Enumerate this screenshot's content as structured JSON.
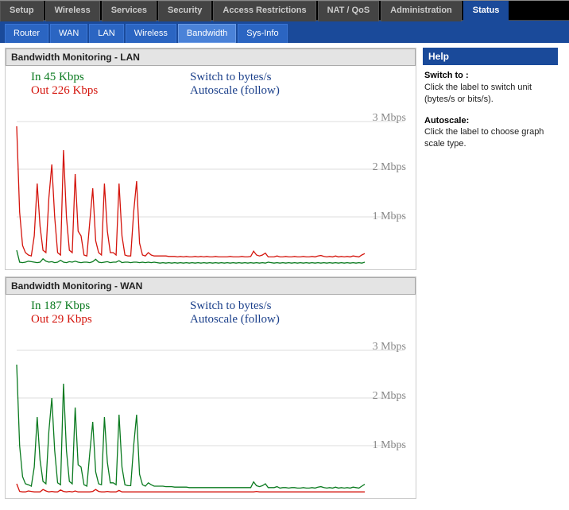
{
  "topnav": [
    {
      "label": "Setup",
      "active": false
    },
    {
      "label": "Wireless",
      "active": false
    },
    {
      "label": "Services",
      "active": false
    },
    {
      "label": "Security",
      "active": false
    },
    {
      "label": "Access Restrictions",
      "active": false
    },
    {
      "label": "NAT / QoS",
      "active": false
    },
    {
      "label": "Administration",
      "active": false
    },
    {
      "label": "Status",
      "active": true
    }
  ],
  "subnav": [
    {
      "label": "Router",
      "active": false
    },
    {
      "label": "WAN",
      "active": false
    },
    {
      "label": "LAN",
      "active": false
    },
    {
      "label": "Wireless",
      "active": false
    },
    {
      "label": "Bandwidth",
      "active": true
    },
    {
      "label": "Sys-Info",
      "active": false
    }
  ],
  "panels": {
    "lan": {
      "title": "Bandwidth Monitoring - LAN",
      "in_prefix": "In  ",
      "in_value": "45 Kbps",
      "out_prefix": "Out  ",
      "out_value": "226 Kbps",
      "switch": "Switch to bytes/s",
      "autoscale": "Autoscale (follow)"
    },
    "wan": {
      "title": "Bandwidth Monitoring - WAN",
      "in_prefix": "In  ",
      "in_value": "187 Kbps",
      "out_prefix": "Out  ",
      "out_value": "29 Kbps",
      "switch": "Switch to bytes/s",
      "autoscale": "Autoscale (follow)"
    }
  },
  "yticks": [
    "3 Mbps",
    "2 Mbps",
    "1 Mbps"
  ],
  "help": {
    "title": "Help",
    "switch_h": "Switch to :",
    "switch_t": "Click the label to switch unit (bytes/s or bits/s).",
    "auto_h": "Autoscale:",
    "auto_t": "Click the label to choose graph scale type."
  },
  "chart_data": [
    {
      "name": "LAN",
      "type": "line",
      "title": "Bandwidth Monitoring - LAN",
      "xlabel": "",
      "ylabel": "",
      "ylim": [
        0,
        3.3
      ],
      "y_unit": "Mbps",
      "y_ticks": [
        1,
        2,
        3
      ],
      "n_samples": 120,
      "series": [
        {
          "name": "In",
          "color": "#0a7a1f",
          "current_kbps": 45,
          "values": [
            0.3,
            0.05,
            0.04,
            0.05,
            0.07,
            0.06,
            0.05,
            0.04,
            0.05,
            0.12,
            0.07,
            0.05,
            0.06,
            0.04,
            0.05,
            0.09,
            0.05,
            0.04,
            0.06,
            0.05,
            0.07,
            0.05,
            0.04,
            0.05,
            0.05,
            0.04,
            0.06,
            0.11,
            0.05,
            0.04,
            0.05,
            0.06,
            0.04,
            0.05,
            0.05,
            0.08,
            0.04,
            0.05,
            0.05,
            0.04,
            0.05,
            0.05,
            0.04,
            0.05,
            0.04,
            0.05,
            0.04,
            0.05,
            0.04,
            0.03,
            0.04,
            0.03,
            0.04,
            0.03,
            0.04,
            0.03,
            0.04,
            0.03,
            0.04,
            0.03,
            0.04,
            0.03,
            0.04,
            0.03,
            0.04,
            0.03,
            0.04,
            0.03,
            0.04,
            0.03,
            0.04,
            0.03,
            0.04,
            0.03,
            0.04,
            0.03,
            0.04,
            0.03,
            0.04,
            0.03,
            0.04,
            0.03,
            0.04,
            0.03,
            0.04,
            0.03,
            0.05,
            0.04,
            0.03,
            0.04,
            0.03,
            0.04,
            0.03,
            0.04,
            0.03,
            0.04,
            0.03,
            0.04,
            0.03,
            0.04,
            0.03,
            0.04,
            0.03,
            0.04,
            0.03,
            0.04,
            0.03,
            0.04,
            0.03,
            0.04,
            0.03,
            0.04,
            0.03,
            0.04,
            0.03,
            0.04,
            0.03,
            0.04,
            0.03,
            0.05
          ]
        },
        {
          "name": "Out",
          "color": "#d4140c",
          "current_kbps": 226,
          "values": [
            2.9,
            1.1,
            0.4,
            0.25,
            0.2,
            0.18,
            0.6,
            1.7,
            0.8,
            0.3,
            0.25,
            1.4,
            2.1,
            1.0,
            0.25,
            0.2,
            2.4,
            1.0,
            0.3,
            0.25,
            1.9,
            0.7,
            0.6,
            0.2,
            0.18,
            0.9,
            1.6,
            0.5,
            0.25,
            0.2,
            1.7,
            0.7,
            0.25,
            0.25,
            0.2,
            1.7,
            0.6,
            0.2,
            0.18,
            0.18,
            1.1,
            1.75,
            0.45,
            0.2,
            0.18,
            0.25,
            0.2,
            0.18,
            0.18,
            0.18,
            0.18,
            0.18,
            0.17,
            0.17,
            0.17,
            0.16,
            0.17,
            0.16,
            0.17,
            0.16,
            0.16,
            0.17,
            0.16,
            0.17,
            0.16,
            0.17,
            0.16,
            0.16,
            0.17,
            0.16,
            0.16,
            0.16,
            0.16,
            0.17,
            0.16,
            0.16,
            0.16,
            0.17,
            0.16,
            0.16,
            0.17,
            0.28,
            0.2,
            0.18,
            0.2,
            0.24,
            0.16,
            0.16,
            0.16,
            0.18,
            0.16,
            0.16,
            0.17,
            0.16,
            0.16,
            0.17,
            0.16,
            0.16,
            0.17,
            0.16,
            0.16,
            0.17,
            0.16,
            0.18,
            0.19,
            0.17,
            0.16,
            0.17,
            0.16,
            0.18,
            0.16,
            0.17,
            0.16,
            0.17,
            0.16,
            0.18,
            0.17,
            0.16,
            0.2,
            0.23
          ]
        }
      ]
    },
    {
      "name": "WAN",
      "type": "line",
      "title": "Bandwidth Monitoring - WAN",
      "xlabel": "",
      "ylabel": "",
      "ylim": [
        0,
        3.3
      ],
      "y_unit": "Mbps",
      "y_ticks": [
        1,
        2,
        3
      ],
      "n_samples": 120,
      "series": [
        {
          "name": "In",
          "color": "#0a7a1f",
          "current_kbps": 187,
          "values": [
            2.7,
            1.0,
            0.35,
            0.2,
            0.18,
            0.15,
            0.55,
            1.6,
            0.7,
            0.25,
            0.2,
            1.3,
            2.0,
            0.9,
            0.22,
            0.18,
            2.3,
            0.9,
            0.25,
            0.2,
            1.8,
            0.6,
            0.55,
            0.18,
            0.15,
            0.85,
            1.5,
            0.45,
            0.2,
            0.18,
            1.6,
            0.65,
            0.22,
            0.22,
            0.18,
            1.65,
            0.55,
            0.18,
            0.16,
            0.16,
            1.0,
            1.65,
            0.4,
            0.18,
            0.15,
            0.22,
            0.18,
            0.15,
            0.15,
            0.15,
            0.15,
            0.14,
            0.14,
            0.14,
            0.13,
            0.13,
            0.13,
            0.13,
            0.13,
            0.12,
            0.12,
            0.12,
            0.12,
            0.12,
            0.12,
            0.12,
            0.12,
            0.12,
            0.12,
            0.12,
            0.12,
            0.12,
            0.12,
            0.12,
            0.12,
            0.12,
            0.12,
            0.12,
            0.12,
            0.12,
            0.12,
            0.24,
            0.16,
            0.14,
            0.16,
            0.2,
            0.12,
            0.12,
            0.12,
            0.14,
            0.11,
            0.12,
            0.12,
            0.11,
            0.12,
            0.12,
            0.11,
            0.11,
            0.12,
            0.11,
            0.11,
            0.12,
            0.11,
            0.13,
            0.14,
            0.12,
            0.11,
            0.12,
            0.11,
            0.13,
            0.11,
            0.12,
            0.11,
            0.12,
            0.11,
            0.13,
            0.12,
            0.11,
            0.15,
            0.19
          ]
        },
        {
          "name": "Out",
          "color": "#d4140c",
          "current_kbps": 29,
          "values": [
            0.2,
            0.04,
            0.03,
            0.03,
            0.05,
            0.04,
            0.03,
            0.03,
            0.03,
            0.08,
            0.05,
            0.03,
            0.04,
            0.03,
            0.03,
            0.07,
            0.04,
            0.03,
            0.04,
            0.03,
            0.05,
            0.03,
            0.03,
            0.03,
            0.03,
            0.03,
            0.04,
            0.08,
            0.04,
            0.03,
            0.03,
            0.04,
            0.03,
            0.03,
            0.03,
            0.06,
            0.03,
            0.03,
            0.03,
            0.03,
            0.03,
            0.03,
            0.03,
            0.03,
            0.03,
            0.03,
            0.03,
            0.03,
            0.03,
            0.03,
            0.03,
            0.03,
            0.03,
            0.03,
            0.03,
            0.03,
            0.03,
            0.03,
            0.03,
            0.03,
            0.03,
            0.03,
            0.03,
            0.03,
            0.03,
            0.03,
            0.03,
            0.03,
            0.03,
            0.03,
            0.03,
            0.03,
            0.03,
            0.03,
            0.03,
            0.03,
            0.03,
            0.03,
            0.03,
            0.03,
            0.03,
            0.03,
            0.04,
            0.03,
            0.03,
            0.03,
            0.03,
            0.03,
            0.03,
            0.03,
            0.03,
            0.03,
            0.03,
            0.03,
            0.03,
            0.03,
            0.03,
            0.03,
            0.03,
            0.03,
            0.03,
            0.03,
            0.03,
            0.03,
            0.03,
            0.03,
            0.03,
            0.03,
            0.03,
            0.03,
            0.03,
            0.03,
            0.03,
            0.03,
            0.03,
            0.03,
            0.03,
            0.03,
            0.03,
            0.03
          ]
        }
      ]
    }
  ]
}
